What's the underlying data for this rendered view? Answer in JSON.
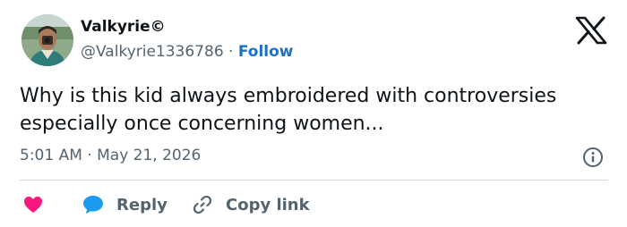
{
  "author": {
    "display_name": "Valkyrie©",
    "handle": "@Valkyrie1336786",
    "separator": "·",
    "follow_label": "Follow",
    "avatar": "profile-photo"
  },
  "tweet": {
    "text": "Why is this kid always embroidered with controversies especially once concerning women...",
    "time": "5:01 AM",
    "date": "May 21, 2026"
  },
  "actions": {
    "reply_label": "Reply",
    "copy_link_label": "Copy link"
  },
  "icons": {
    "brand": "x-logo-icon",
    "info": "info-icon",
    "like": "heart-icon",
    "reply": "speech-bubble-icon",
    "copy": "link-icon"
  },
  "colors": {
    "text": "#0f1419",
    "secondary": "#536471",
    "link": "#1d70c8",
    "like": "#f91880",
    "reply": "#1d9bf0",
    "divider": "#cfd9de"
  }
}
